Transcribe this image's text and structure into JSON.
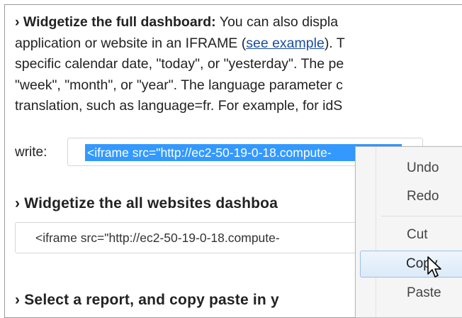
{
  "section1": {
    "bold": "› Widgetize the full dashboard:",
    "line1_rest": " You can also displa",
    "line2_pre": "application or website in an IFRAME (",
    "link": "see example",
    "line2_post": "). T",
    "line3": "specific calendar date, \"today\", or \"yesterday\". The pe",
    "line4": "\"week\", \"month\", or \"year\". The language parameter c",
    "line5": "translation, such as language=fr. For example, for idS",
    "write_label": "write:",
    "code": "<iframe src=\"http://ec2-50-19-0-18.compute-"
  },
  "section2": {
    "heading": "› Widgetize the all websites dashboa",
    "code": "<iframe src=\"http://ec2-50-19-0-18.compute-"
  },
  "section3": {
    "heading": "› Select a report, and copy paste in y"
  },
  "context_menu": {
    "undo": "Undo",
    "redo": "Redo",
    "cut": "Cut",
    "copy": "Copy",
    "paste": "Paste"
  },
  "colors": {
    "selection": "#3399ff",
    "link": "#1a4d9e",
    "menu_hover": "#dceaf9"
  },
  "icons": {
    "cursor": "arrow-cursor-icon"
  }
}
